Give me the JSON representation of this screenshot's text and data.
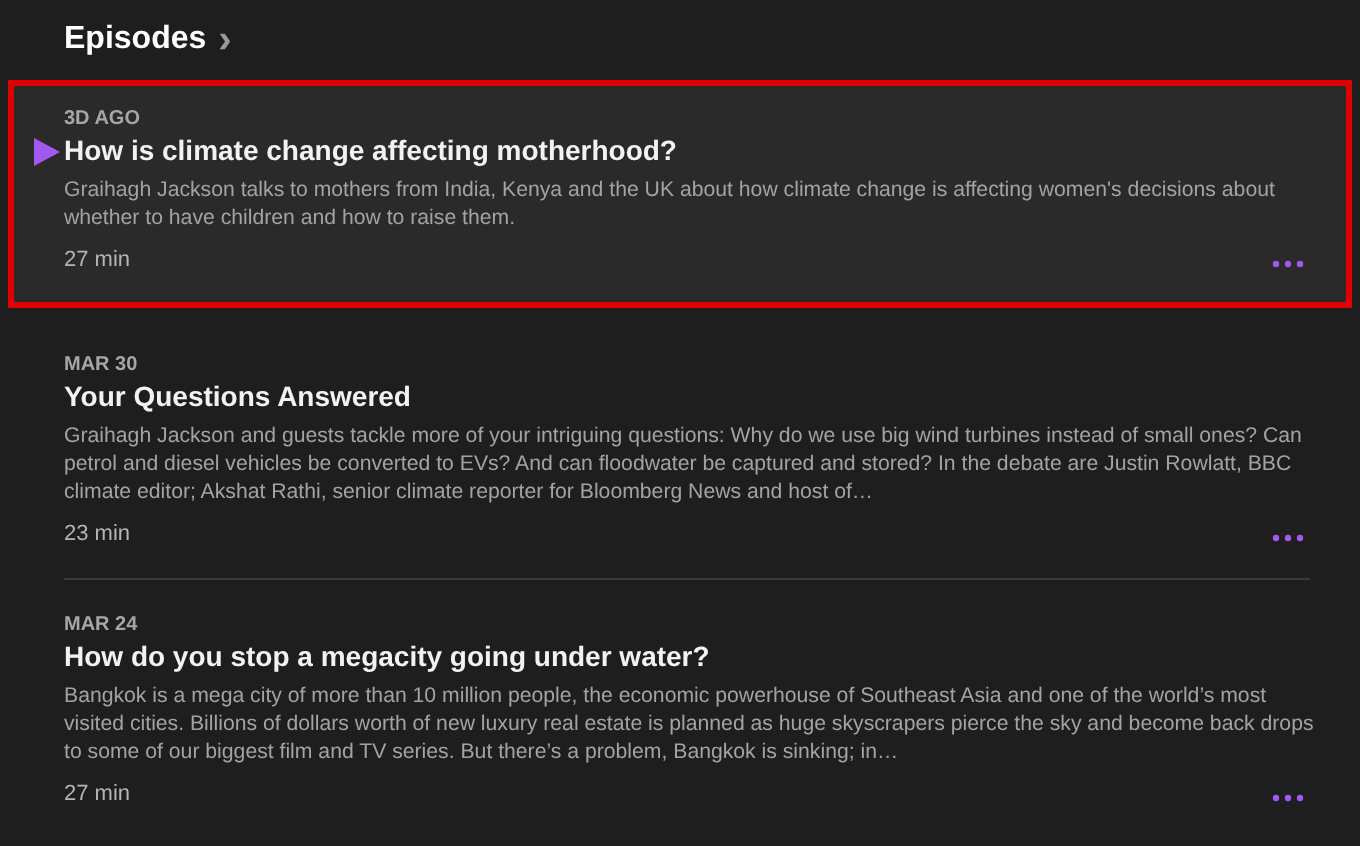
{
  "section": {
    "title": "Episodes",
    "chevron": "›"
  },
  "episodes": [
    {
      "date": "3D AGO",
      "title": "How is climate change affecting motherhood?",
      "description": "Graihagh Jackson talks to mothers from India, Kenya and the UK about how climate change is affecting women's decisions about whether to have children and how to raise them.",
      "duration": "27 min",
      "selected": true
    },
    {
      "date": "MAR 30",
      "title": "Your Questions Answered",
      "description": "Graihagh Jackson and guests tackle more of your intriguing questions: Why do we use big wind turbines instead of small ones? Can petrol and diesel vehicles be converted to EVs? And can floodwater be captured and stored? In the debate are Justin Rowlatt, BBC climate editor; Akshat Rathi, senior climate reporter for Bloomberg News and host of…",
      "duration": "23 min",
      "selected": false
    },
    {
      "date": "MAR 24",
      "title": "How do you stop a megacity going under water?",
      "description": "Bangkok is a mega city of more than 10 million people, the economic powerhouse of Southeast Asia and one of the world’s most visited cities. Billions of dollars worth of new luxury real estate is planned as huge skyscrapers pierce the sky and become back drops to some of our biggest film and TV series. But there’s a problem, Bangkok is sinking; in…",
      "duration": "27 min",
      "selected": false
    }
  ]
}
